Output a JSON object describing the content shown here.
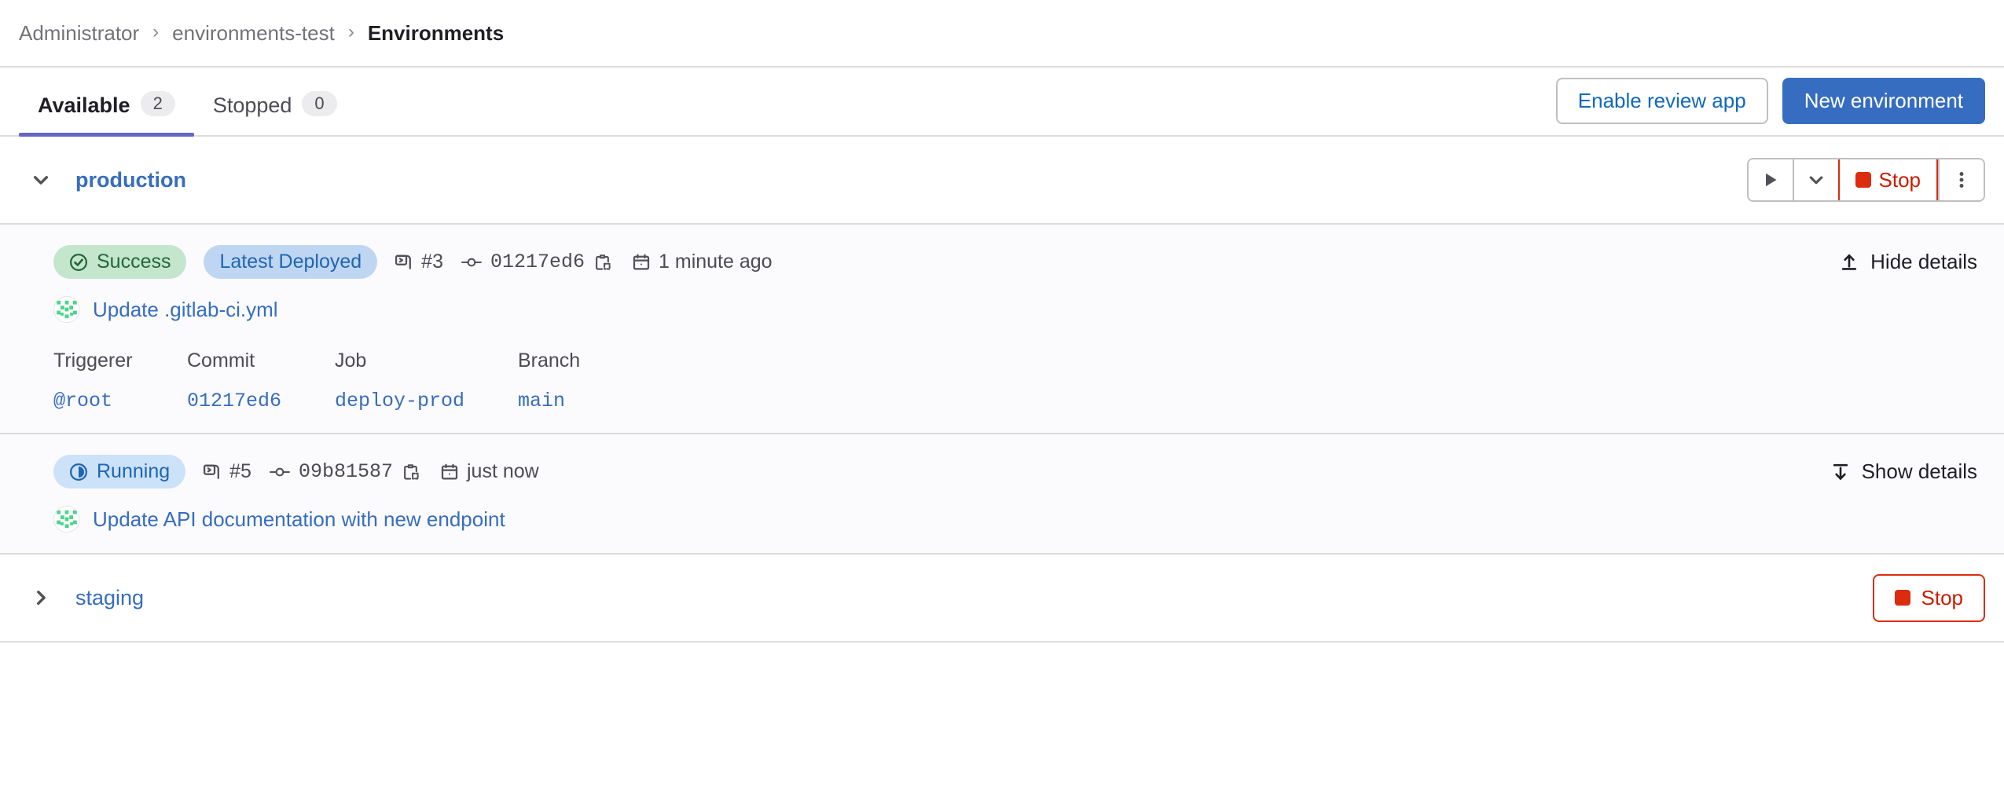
{
  "breadcrumb": {
    "items": [
      {
        "label": "Administrator",
        "current": false
      },
      {
        "label": "environments-test",
        "current": false
      },
      {
        "label": "Environments",
        "current": true
      }
    ],
    "separator": "›"
  },
  "tabs": [
    {
      "label": "Available",
      "count": "2",
      "active": true
    },
    {
      "label": "Stopped",
      "count": "0",
      "active": false
    }
  ],
  "header_actions": {
    "enable_review_app": "Enable review app",
    "new_environment": "New environment"
  },
  "colors": {
    "accent_tab": "#6666c4",
    "link_blue": "#366dc0",
    "primary_button": "#366dc0",
    "danger_red": "#dd2b0e",
    "danger_text": "#c91c00",
    "badge_success_bg": "#c3e6cd",
    "badge_success_text": "#24663b",
    "badge_info_bg": "#bfd6f2",
    "badge_info_text": "#1f65b2",
    "row_background": "#fbfafd",
    "border": "#dcdcde"
  },
  "environments": [
    {
      "name": "production",
      "expanded": true,
      "chevron_icon": "chevron-down-icon",
      "actions": {
        "play_icon": "play-icon",
        "play_dropdown_icon": "chevron-down-icon",
        "stop_label": "Stop",
        "stop_icon": "stop-square-icon",
        "more_icon": "ellipsis-vertical-icon"
      },
      "deployments": [
        {
          "status_badge": {
            "label": "Success",
            "type": "success",
            "icon": "check-circle-icon"
          },
          "extra_badge": {
            "label": "Latest Deployed",
            "type": "info"
          },
          "pipeline": {
            "icon": "pipeline-icon",
            "label": "#3"
          },
          "commit_sha": {
            "icon": "commit-icon",
            "label": "01217ed6",
            "copy_icon": "copy-to-clipboard-icon"
          },
          "time": {
            "icon": "calendar-icon",
            "label": "1 minute ago"
          },
          "details_toggle": {
            "label": "Hide details",
            "icon": "collapse-up-icon"
          },
          "commit": {
            "avatar": "user-avatar",
            "title": "Update .gitlab-ci.yml"
          },
          "details": {
            "headers": [
              "Triggerer",
              "Commit",
              "Job",
              "Branch"
            ],
            "values": [
              "@root",
              "01217ed6",
              "deploy-prod",
              "main"
            ]
          }
        },
        {
          "status_badge": {
            "label": "Running",
            "type": "running",
            "icon": "running-clock-icon"
          },
          "extra_badge": null,
          "pipeline": {
            "icon": "pipeline-icon",
            "label": "#5"
          },
          "commit_sha": {
            "icon": "commit-icon",
            "label": "09b81587",
            "copy_icon": "copy-to-clipboard-icon"
          },
          "time": {
            "icon": "calendar-icon",
            "label": "just now"
          },
          "details_toggle": {
            "label": "Show details",
            "icon": "expand-down-icon"
          },
          "commit": {
            "avatar": "user-avatar",
            "title": "Update API documentation with new endpoint"
          },
          "details": null
        }
      ]
    },
    {
      "name": "staging",
      "expanded": false,
      "chevron_icon": "chevron-right-icon",
      "actions": {
        "stop_label": "Stop",
        "stop_icon": "stop-square-icon"
      },
      "deployments": []
    }
  ]
}
